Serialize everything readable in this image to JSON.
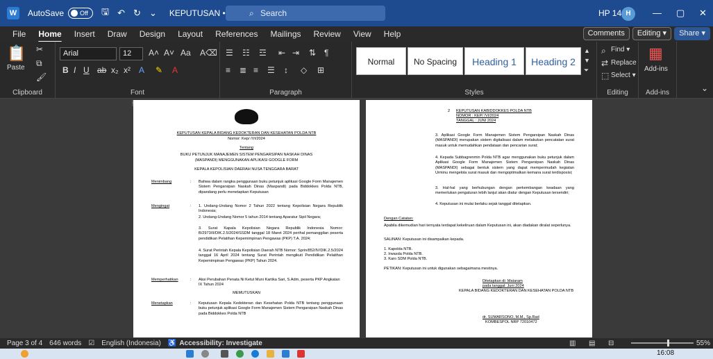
{
  "titlebar": {
    "autosave_label": "AutoSave",
    "autosave_state": "Off",
    "doc_name": "KEPUTUSAN • Saved ∨",
    "search_placeholder": "Search",
    "user_name": "HP 14s",
    "user_initial": "H",
    "minimize": "—",
    "maximize": "▢",
    "close": "✕"
  },
  "menu": {
    "items": [
      "File",
      "Home",
      "Insert",
      "Draw",
      "Design",
      "Layout",
      "References",
      "Mailings",
      "Review",
      "View",
      "Help"
    ],
    "active_index": 1,
    "comments": "Comments",
    "editing": "Editing ▾",
    "share": "Share ▾"
  },
  "ribbon": {
    "clipboard": {
      "paste": "Paste",
      "label": "Clipboard"
    },
    "font": {
      "family": "Arial",
      "size": "12",
      "label": "Font"
    },
    "paragraph": {
      "label": "Paragraph"
    },
    "styles": {
      "label": "Styles",
      "items": [
        "Normal",
        "No Spacing",
        "Heading 1",
        "Heading 2"
      ]
    },
    "editing": {
      "find": "Find ▾",
      "replace": "Replace",
      "select": "Select ▾",
      "label": "Editing"
    },
    "addins": {
      "button": "Add-ins",
      "label": "Add-ins"
    }
  },
  "left_page": {
    "title": "KEPUTUSAN KEPALA BIDANG KEDOKTERAN DAN KESEHATAN POLDA NTB",
    "nomor": "Nomor: Kep/         /VI/2024",
    "tentang": "Tentang",
    "subject1": "BUKU PETUNJUK MANAJEMEN SISTEM PENGARSIPAN NASKAH DINAS",
    "subject2": "(MASPANDI) MENGGUNAKAN APLIKASI GOOGLE FORM",
    "kepala": "KEPALA KEPOLISIAN DAERAH NUSA TENGGARA BARAT",
    "menimbang_label": "Menimbang",
    "menimbang_text": "Bahwa dalam rangka penggunaan buku petunjuk aplikasi Google Form Manajemen Sistem Pengarsipan Naskah Dinas (Maspandi) pada Biddokkes Polda NTB, dipandang perlu menetapkan Keputusan",
    "mengingat_label": "Mengingat",
    "mengingat_items": [
      "1.  Undang-Undang Nomor 2 Tahun 2022 tentang Kepolisian Negara Republik Indonesia;",
      "2.  Undang-Undang Nomor 5 tahun 2014 tentang Aparatur Sipil Negara;",
      "3.  Surat Kapala Kepolisian Negara Republik Indonesia Nomor: B/2973/II/DIK.2.5/2024/SSDM tanggal 18 Maret 2024 perihal pemanggilan peserta pendidikan Pelatihan Kepemimpinan Pengawas (PKP) T.A. 2024;",
      "4.  Surat Perintah Kepala Kepolisian Daerah NTB Nomor: Sprin/852/IV/DIK.2.5/2024 tanggal 16 April 2024 tentang Surat Perintah mengikuti Pendidikan Pelatihan Kepemimpinan Pengawas (PKP) Tahun 2024."
    ],
    "memperhatikan_label": "Memperhatikan",
    "memperhatikan_text": "Aksi Perubahan Penata Ni Ketut Muni Kartika Sari, S.Adm, peserta PKP Angkatan IX Tahun 2024",
    "memutuskan": "MEMUTUSKAN",
    "menetapkan_label": "Menetapkan",
    "menetapkan_text": "Keputusan Kepala Kedokteran dan Kesehatan Polda NTB tentang penggunaan buku petunjuk aplikasi Google Form Manajemen Sistem Pengarsipan Naskah Dinas pada Biddokkes Polda NTB"
  },
  "right_page": {
    "header_num": "2",
    "header1": "KEPUTUSAN KABIDDOKKES POLDA NTB",
    "header2": "NOMOR : KEP/          /VI/2024",
    "header3": "TANGGAL :           JUNI   2024",
    "items": [
      "3.  Aplikasi Google Form Manajemen Sistem Pengarsipan Naskah Dinas (MASPANDI) merupakan sistem digitalisasi dalam melakukan pencatatan surat masuk untuk memudahkan pendataan dan pencarian surat;",
      "4.  Kepada Subbagrenmin Polda NTB agar menggunakan buku petunjuk dalam Aplikasi Google Form Manajemen Sistem Pengarsipan Naskah Dinas (MASPANDI) sebagai bentuk sistem yang dapat mempermudah kegiatan Urminu mengelola surat masuk dan mengoptimalkan kemana surat terdisposisi;",
      "3.  Hal-hal yang berhubungan dengan perkembangan keadaan yang memerlukan pengaturan lebih lanjut akan diatur dengan Keputusan tersendiri;",
      "4.  Keputusan ini mulai berlaku sejak tanggal ditetapkan."
    ],
    "catatan": "Dengan Catatan:",
    "catatan_text": "Apabila dikemudian hari ternyata terdapat kekeliruan dalam Keputusan ini, akan diadakan diralat seperlunya.",
    "salinan": "SALINAN: Keputusan ini disampaikan kepada.",
    "salinan_list": [
      "1. Kapolda NTB.",
      "2. Irwasda Polda NTB.",
      "3. Karo SDM Polda NTB."
    ],
    "petikan": "PETIKAN: Keputusan ini untuk digunakan sebagaimana mestinya.",
    "ditetapkan": "Ditetapkan di:   Mataram",
    "pada_tanggal": "pada tanggal:           Juni   2024",
    "kepala_bidang": "KEPALA BIDANG KEDOKTERAN DAN KESEHATAN POLDA NTB",
    "signer": "dr. SUMARSONO, M.M., Sp.Rad",
    "signer_rank": "KOMBESPOL NRP 72010472"
  },
  "statusbar": {
    "page": "Page 3 of 4",
    "words": "646 words",
    "language": "English (Indonesia)",
    "accessibility": "Accessibility: Investigate",
    "zoom": "55%"
  },
  "taskbar": {
    "time": "16:08"
  }
}
